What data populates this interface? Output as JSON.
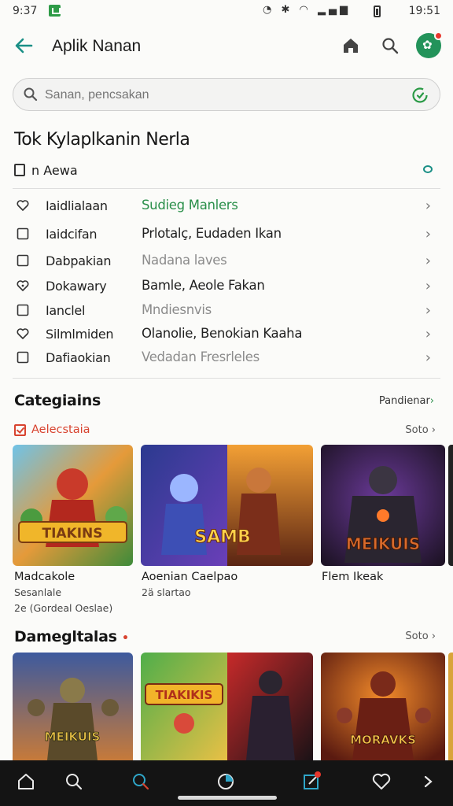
{
  "status_bar": {
    "time": "9:37",
    "clock": "19:51"
  },
  "app_bar": {
    "title": "Aplik Nanan"
  },
  "search": {
    "placeholder": "Sanan, pencsakan"
  },
  "list_section": {
    "title": "Tok Kylaplkanin Nerla",
    "subhead": "n Aewa",
    "rows": [
      {
        "icon": "heart-icon",
        "col1": "Iaidlialaan",
        "col2": "Sudieg Manlers",
        "col2_style": "green"
      },
      {
        "icon": "checkbox-icon",
        "col1": "Iaidcifan",
        "col2": "Prlotalç, Eudaden Ikan",
        "col2_style": "normal"
      },
      {
        "icon": "checkbox-icon",
        "col1": "Dabpakian",
        "col2": "Nadana laves",
        "col2_style": "gray"
      },
      {
        "icon": "heart-outline-icon",
        "col1": "Dokawary",
        "col2": "Bamle, Aeole Fakan",
        "col2_style": "normal"
      },
      {
        "icon": "checkbox-icon",
        "col1": "Ianclel",
        "col2": "Mndiesnvis",
        "col2_style": "gray"
      },
      {
        "icon": "heart-icon",
        "col1": "Silmlmiden",
        "col2": "Olanolie, Benokian Kaaha",
        "col2_style": "normal"
      },
      {
        "icon": "checkbox-icon",
        "col1": "Dafiaokian",
        "col2": "Vedadan Fresrleles",
        "col2_style": "gray"
      }
    ]
  },
  "categories": {
    "title": "Categiains",
    "link": "Pandienar",
    "filter_label": "Aelecstaia",
    "see_all": "Soto",
    "cards": [
      {
        "title": "Madcakole",
        "meta1": "Sesanlale",
        "meta2": "2e (Gordeal Oeslae)",
        "art_text": "TIAKINS",
        "palette": "warm-green"
      },
      {
        "title": "Aoenian Caelpao",
        "meta1": "2ä slartao",
        "meta2": "",
        "art_text": "SAMB",
        "palette": "blue-orange"
      },
      {
        "title": "Flem Ikeak",
        "meta1": "",
        "meta2": "",
        "art_text": "MEIKUIS",
        "palette": "purple-dark"
      }
    ]
  },
  "damegotalas": {
    "title": "Damegltalas",
    "see_all": "Soto",
    "cards": [
      {
        "art_text": "MEIKUIS",
        "palette": "dusk"
      },
      {
        "art_text": "TIAKIKIS",
        "palette": "sunny"
      },
      {
        "art_text": "",
        "palette": "red-dark"
      },
      {
        "art_text": "MORAVKS",
        "palette": "fire"
      }
    ]
  },
  "colors": {
    "accent_teal": "#1a8f86",
    "accent_green": "#2a8f4a",
    "accent_red": "#d8432f",
    "nav_bg": "#141414"
  },
  "bottom_nav": [
    "home-icon",
    "search-icon",
    "explore-icon",
    "pie-icon",
    "edit-icon",
    "heart-icon",
    "more-icon"
  ]
}
